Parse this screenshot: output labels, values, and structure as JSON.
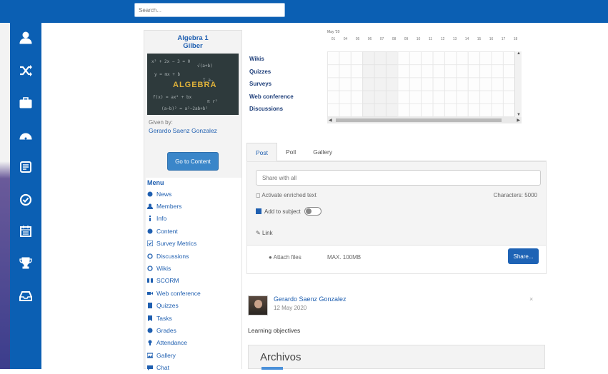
{
  "topbar": {
    "brand": "",
    "search_placeholder": "Search..."
  },
  "sidebar": {
    "icons": [
      "user-icon",
      "shuffle-icon",
      "briefcase-icon",
      "dashboard-icon",
      "newspaper-icon",
      "check-circle-icon",
      "calendar-icon",
      "trophy-icon",
      "inbox-icon"
    ]
  },
  "course": {
    "title_line1": "Algebra 1",
    "title_line2": "Gilber",
    "image_text": "ALGEBRA",
    "given_by_label": "Given by:",
    "given_by_name": "Gerardo Saenz Gonzalez",
    "go_button": "Go to Content"
  },
  "menu": {
    "title": "Menu",
    "items": [
      {
        "icon": "news-icon",
        "label": "News"
      },
      {
        "icon": "members-icon",
        "label": "Members"
      },
      {
        "icon": "info-icon",
        "label": "Info"
      },
      {
        "icon": "content-icon",
        "label": "Content"
      },
      {
        "icon": "survey-icon",
        "label": "Survey Metrics"
      },
      {
        "icon": "discussion-icon",
        "label": "Discussions"
      },
      {
        "icon": "wiki-icon",
        "label": "Wikis"
      },
      {
        "icon": "scorm-icon",
        "label": "SCORM"
      },
      {
        "icon": "video-icon",
        "label": "Web conference"
      },
      {
        "icon": "quiz-icon",
        "label": "Quizzes"
      },
      {
        "icon": "tasks-icon",
        "label": "Tasks"
      },
      {
        "icon": "grades-icon",
        "label": "Grades"
      },
      {
        "icon": "attendance-icon",
        "label": "Attendance"
      },
      {
        "icon": "gallery-icon",
        "label": "Gallery"
      },
      {
        "icon": "chat-icon",
        "label": "Chat"
      }
    ]
  },
  "activity": {
    "month": "May '20",
    "days": [
      "01",
      "04",
      "05",
      "06",
      "07",
      "08",
      "09",
      "10",
      "11",
      "12",
      "13",
      "14",
      "15",
      "16",
      "17",
      "18"
    ],
    "rows": [
      "Wikis",
      "Quizzes",
      "Surveys",
      "Web conference",
      "Discussions"
    ]
  },
  "composer": {
    "tabs": [
      "Post",
      "Poll",
      "Gallery"
    ],
    "active_tab": "Post",
    "share_placeholder": "Share with all",
    "enriched_text": "Activate enriched text",
    "characters": "Characters: 5000",
    "add_to_subject": "Add to subject",
    "link": "Link",
    "attach_files": "Attach files",
    "max_size": "MAX. 100MB",
    "share_button": "Share..."
  },
  "post": {
    "author": "Gerardo Saenz Gonzalez",
    "date": "12 May 2020",
    "close": "×",
    "body": "Learning objectives",
    "archivos": "Archivos"
  },
  "colors": {
    "primary": "#0b5fb3",
    "link": "#1f5fb0",
    "button": "#1e63b5"
  }
}
